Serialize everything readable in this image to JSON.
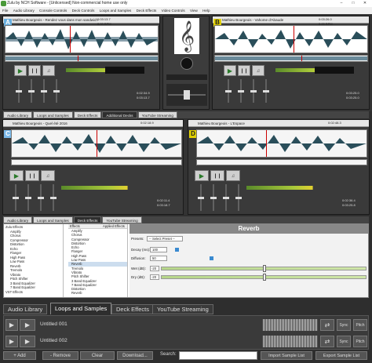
{
  "window": {
    "title": "Zulu by NCH Software - [Unlicensed] Non-commercial home use only"
  },
  "menu": [
    "File",
    "Audio Library",
    "Console Controls",
    "Deck Controls",
    "Loops and Samples",
    "Deck Effects",
    "Video Controls",
    "View",
    "Help"
  ],
  "deck_a": {
    "letter": "A",
    "track": "Mathieu Bourgeois - Rendez vous dans mon sandwich",
    "time": "0:03:13.7",
    "bpm": "0.00 BPM",
    "elapsed": "0:03:13.7",
    "remaining": "0:02:22.9",
    "pitch": "0.0%",
    "pitch_time": "0:02:34.9",
    "end_time": "0:03:13.7"
  },
  "deck_b": {
    "letter": "B",
    "track": "Mathieu Bourgeois - Vahome d'Abaude",
    "time": "0:03:26.0",
    "bpm": "0.00 BPM",
    "elapsed": "0:03:26.0",
    "remaining": "0:01:57.7",
    "pitch": "0.0%",
    "pitch_time": "0:03:25.0",
    "end_time": "0:03:25.0"
  },
  "deck_c": {
    "letter": "C",
    "track": "Mathieu Bourgeois - Quel été 2016",
    "time": "0:02:18.9",
    "bpm": "0.00 BPM",
    "elapsed": "0:01:51.7",
    "remaining": "0:03:09.2",
    "pitch_time": "0:02:11.4",
    "end_time": "0:03:18.7"
  },
  "deck_d": {
    "letter": "D",
    "track": "Mathieu Bourgeois - L'Espace",
    "time": "0:02:48.3",
    "bpm": "0.00 BPM",
    "elapsed": "0:02:48.3",
    "remaining": "0:01:24.4",
    "pitch_time": "0:02:36.4",
    "end_time": "0:03:25.8"
  },
  "upper_tabs": [
    "Audio Library",
    "Loops and Samples",
    "Deck Effects",
    "Additional Decks",
    "YouTube Streaming"
  ],
  "mid_tabs": [
    "Audio Library",
    "Loops and Samples",
    "Deck Effects",
    "YouTube Streaming"
  ],
  "effects_tree": [
    "Zulu Effects",
    "Amplify",
    "Chorus",
    "Compressor",
    "Distortion",
    "Echo",
    "Flanger",
    "High Pass",
    "Low Pass",
    "Reverb",
    "Tremolo",
    "Vibrato",
    "Pitch Shifter",
    "3 Band Equalizer",
    "7 Band Equalizer",
    "VST Effects"
  ],
  "effects_list": {
    "col1": "Effects",
    "col2": "Applied Effects",
    "items": [
      "Amplify",
      "Chorus",
      "Compressor",
      "Distortion",
      "Echo",
      "Flanger",
      "High Pass",
      "Low Pass",
      "Reverb",
      "Tremolo",
      "Vibrato",
      "Pitch Shifter",
      "3 Band Equalizer",
      "7 Band Equalizer",
      "Distortion",
      "Reverb"
    ]
  },
  "reverb": {
    "title": "Reverb",
    "presets_label": "Presets:",
    "presets_value": "-- Select Preset --",
    "decay_label": "Decay (ms):",
    "decay_value": "100",
    "diffusion_label": "Diffusion:",
    "diffusion_value": "50",
    "wet_label": "Wet (dB):",
    "wet_value": "-20",
    "dry_label": "Dry (dB):",
    "dry_value": "-20"
  },
  "bottom_tabs": [
    "Audio Library",
    "Loops and Samples",
    "Deck Effects",
    "YouTube Streaming"
  ],
  "samples": [
    {
      "name": "Untitled 001"
    },
    {
      "name": "Untitled 002"
    }
  ],
  "sample_buttons": {
    "sync": "Sync",
    "pitch": "Pitch"
  },
  "footer": {
    "add": "+ Add",
    "remove": "- Remove",
    "clear": "Clear",
    "download": "Download...",
    "search_label": "Search:",
    "import": "Import Sample List",
    "export": "Export Sample List"
  },
  "colors": {
    "deck_a": "#6ab0e0",
    "deck_b": "#e0d000",
    "bg": "#2e2e2e",
    "play": "#2a7a2a"
  }
}
